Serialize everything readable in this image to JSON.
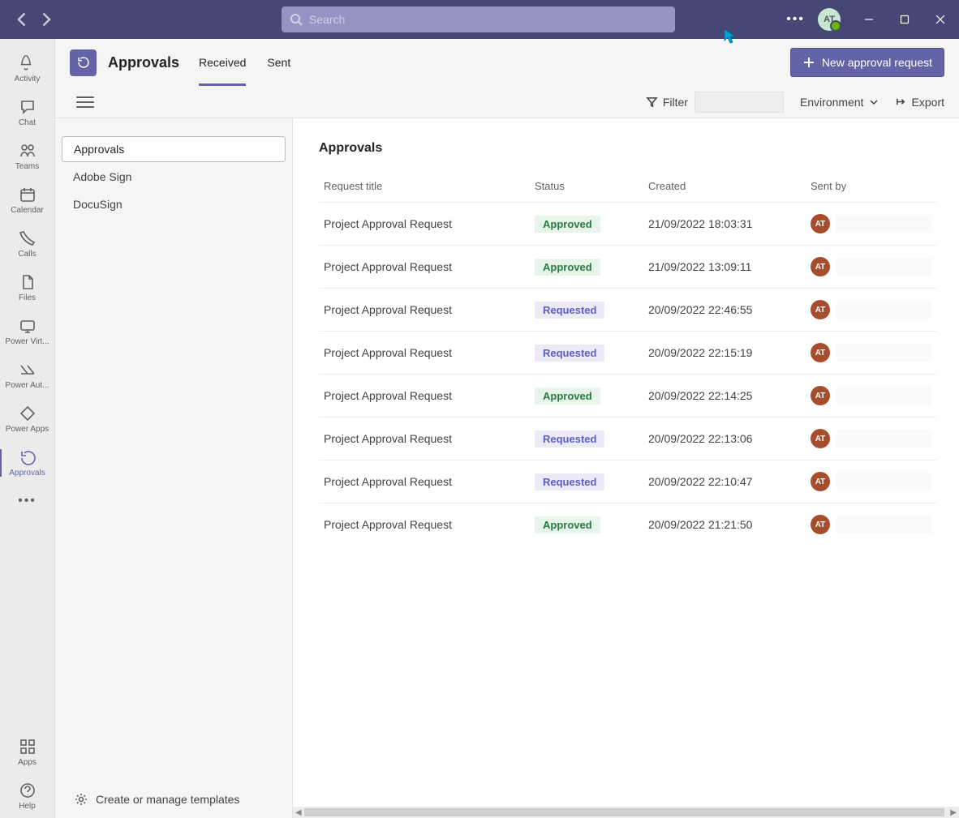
{
  "titlebar": {
    "search_placeholder": "Search",
    "avatar_initials": "AT"
  },
  "rail": {
    "items": [
      {
        "label": "Activity",
        "icon": "bell"
      },
      {
        "label": "Chat",
        "icon": "chat"
      },
      {
        "label": "Teams",
        "icon": "teams"
      },
      {
        "label": "Calendar",
        "icon": "calendar"
      },
      {
        "label": "Calls",
        "icon": "calls"
      },
      {
        "label": "Files",
        "icon": "files"
      },
      {
        "label": "Power Virt...",
        "icon": "pvirt"
      },
      {
        "label": "Power Aut...",
        "icon": "flow"
      },
      {
        "label": "Power Apps",
        "icon": "papps"
      },
      {
        "label": "Approvals",
        "icon": "approvals",
        "active": true
      }
    ],
    "bottom": [
      {
        "label": "Apps",
        "icon": "apps"
      },
      {
        "label": "Help",
        "icon": "help"
      }
    ]
  },
  "ribbon": {
    "title": "Approvals",
    "tabs": [
      {
        "label": "Received",
        "selected": true
      },
      {
        "label": "Sent",
        "selected": false
      }
    ],
    "new_button": "New approval request"
  },
  "toolbar": {
    "filter": "Filter",
    "environment": "Environment",
    "export": "Export"
  },
  "sidebar": {
    "items": [
      {
        "label": "Approvals",
        "selected": true
      },
      {
        "label": "Adobe Sign",
        "selected": false
      },
      {
        "label": "DocuSign",
        "selected": false
      }
    ],
    "templates": "Create or manage templates"
  },
  "table": {
    "title": "Approvals",
    "columns": {
      "request_title": "Request title",
      "status": "Status",
      "created": "Created",
      "sent_by": "Sent by"
    },
    "rows": [
      {
        "title": "Project Approval Request",
        "status": "Approved",
        "created": "21/09/2022 18:03:31",
        "sent_by": "AT"
      },
      {
        "title": "Project Approval Request",
        "status": "Approved",
        "created": "21/09/2022 13:09:11",
        "sent_by": "AT"
      },
      {
        "title": "Project Approval Request",
        "status": "Requested",
        "created": "20/09/2022 22:46:55",
        "sent_by": "AT"
      },
      {
        "title": "Project Approval Request",
        "status": "Requested",
        "created": "20/09/2022 22:15:19",
        "sent_by": "AT"
      },
      {
        "title": "Project Approval Request",
        "status": "Approved",
        "created": "20/09/2022 22:14:25",
        "sent_by": "AT"
      },
      {
        "title": "Project Approval Request",
        "status": "Requested",
        "created": "20/09/2022 22:13:06",
        "sent_by": "AT"
      },
      {
        "title": "Project Approval Request",
        "status": "Requested",
        "created": "20/09/2022 22:10:47",
        "sent_by": "AT"
      },
      {
        "title": "Project Approval Request",
        "status": "Approved",
        "created": "20/09/2022 21:21:50",
        "sent_by": "AT"
      }
    ]
  }
}
